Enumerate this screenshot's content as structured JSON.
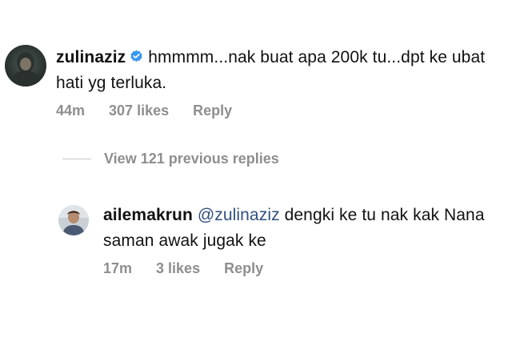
{
  "main_comment": {
    "username": "zulinaziz",
    "verified_icon": "verified-badge-icon",
    "text": "hmmmm...nak buat apa 200k tu...dpt ke ubat hati yg terluka.",
    "time": "44m",
    "likes": "307 likes",
    "reply_label": "Reply"
  },
  "view_replies": {
    "label": "View 121 previous replies"
  },
  "reply_comment": {
    "username": "ailemakrun",
    "mention": "@zulinaziz",
    "text": "dengki ke tu nak kak Nana saman awak jugak ke",
    "time": "17m",
    "likes": "3 likes",
    "reply_label": "Reply"
  },
  "colors": {
    "meta_gray": "#8e8e8e",
    "mention_blue": "#2f4f7f",
    "verified_blue": "#3897f0"
  }
}
